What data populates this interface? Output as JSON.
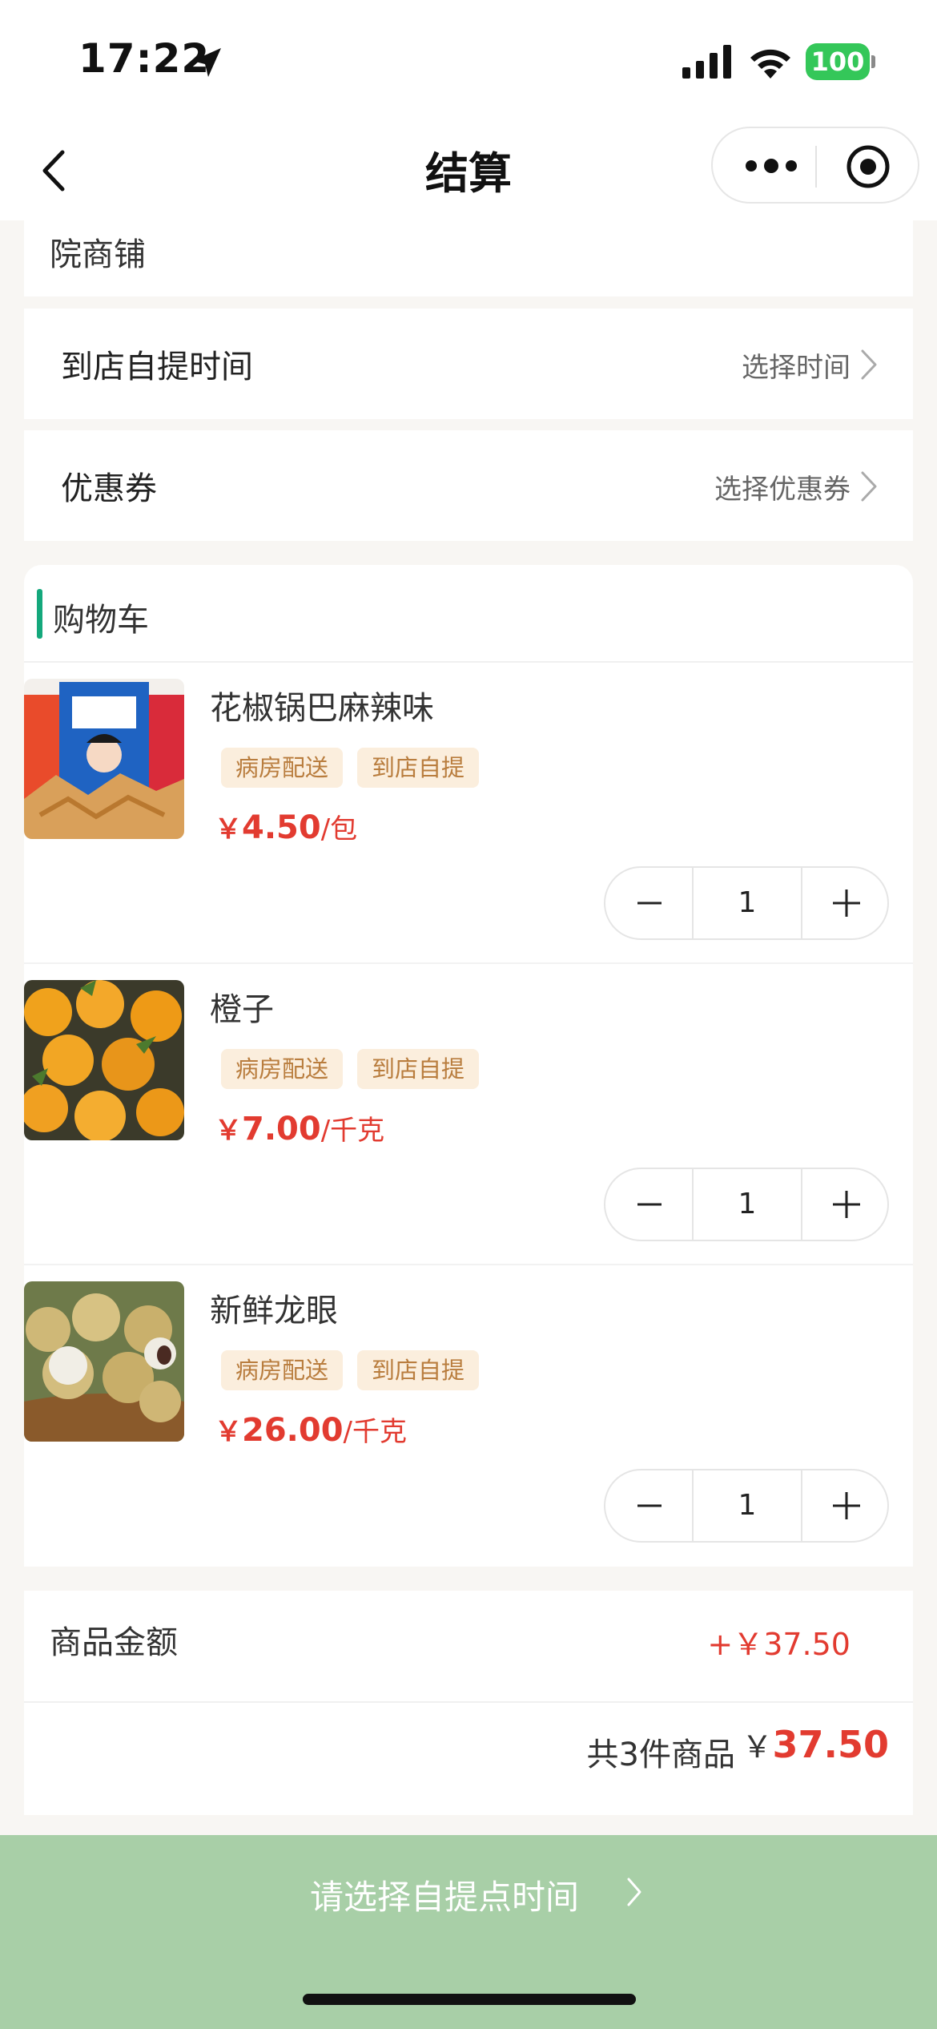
{
  "status_bar": {
    "time": "17:22",
    "battery": "100"
  },
  "nav": {
    "title": "结算"
  },
  "shop": {
    "name": "院商铺"
  },
  "pickup": {
    "label": "到店自提时间",
    "value": "选择时间"
  },
  "coupon": {
    "label": "优惠券",
    "value": "选择优惠券"
  },
  "cart": {
    "title": "购物车",
    "items": [
      {
        "name": "花椒锅巴麻辣味",
        "tags": [
          "病房配送",
          "到店自提"
        ],
        "currency": "￥",
        "price": "4.50",
        "unit": "/包",
        "qty": "1"
      },
      {
        "name": "橙子",
        "tags": [
          "病房配送",
          "到店自提"
        ],
        "currency": "￥",
        "price": "7.00",
        "unit": "/千克",
        "qty": "1"
      },
      {
        "name": "新鲜龙眼",
        "tags": [
          "病房配送",
          "到店自提"
        ],
        "currency": "￥",
        "price": "26.00",
        "unit": "/千克",
        "qty": "1"
      }
    ]
  },
  "summary": {
    "goods_label": "商品金额",
    "goods_value": "+￥37.50",
    "count_text": "共3件商品",
    "total_currency": "￥",
    "total_value": "37.50"
  },
  "submit": {
    "label": "请选择自提点时间"
  },
  "colors": {
    "accent": "#14a87c",
    "price": "#e23b30",
    "tag_bg": "#fbeedd",
    "tag_text": "#b97d3e",
    "submit_bg": "#a8cfa7"
  }
}
